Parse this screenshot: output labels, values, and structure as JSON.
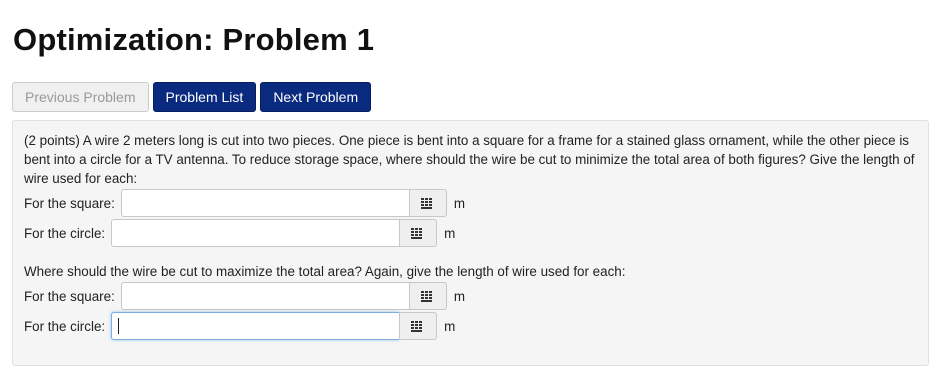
{
  "page": {
    "title": "Optimization: Problem 1"
  },
  "nav": {
    "previous_label": "Previous Problem",
    "list_label": "Problem List",
    "next_label": "Next Problem"
  },
  "problem": {
    "statement": "(2 points) A wire 2 meters long is cut into two pieces. One piece is bent into a square for a frame for a stained glass ornament, while the other piece is bent into a circle for a TV antenna. To reduce storage space, where should the wire be cut to minimize the total area of both figures? Give the length of wire used for each:",
    "part1": {
      "square_label": "For the square:",
      "square_value": "",
      "square_unit": "m",
      "circle_label": "For the circle:",
      "circle_value": "",
      "circle_unit": "m"
    },
    "part2_prompt": "Where should the wire be cut to maximize the total area? Again, give the length of wire used for each:",
    "part2": {
      "square_label": "For the square:",
      "square_value": "",
      "square_unit": "m",
      "circle_label": "For the circle:",
      "circle_value": "",
      "circle_unit": "m"
    }
  },
  "icons": {
    "input_helper": "keyboard-grid-icon"
  }
}
